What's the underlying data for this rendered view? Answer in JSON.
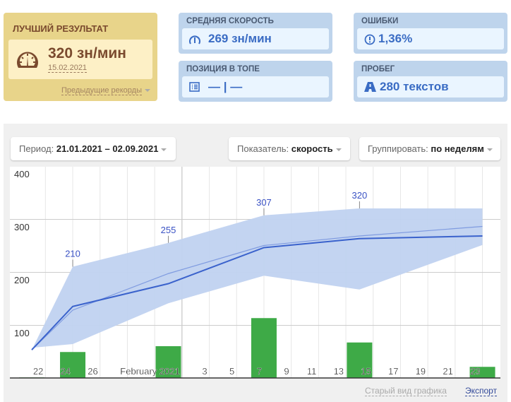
{
  "best": {
    "title": "ЛУЧШИЙ РЕЗУЛЬТАТ",
    "value": "320 зн/мин",
    "date": "15.02.2021",
    "prev_label": "Предыдущие рекорды",
    "icon": "speedometer-icon"
  },
  "avg_speed": {
    "title": "СРЕДНЯЯ СКОРОСТЬ",
    "value": "269 зн/мин",
    "icon": "speedometer-icon"
  },
  "errors": {
    "title": "ОШИБКИ",
    "value": "1,36%",
    "icon": "exclamation-circle-icon"
  },
  "position": {
    "title": "ПОЗИЦИЯ В ТОПЕ",
    "value": "— | —",
    "icon": "list-icon"
  },
  "mileage": {
    "title": "ПРОБЕГ",
    "value": "280 текстов",
    "icon": "road-icon"
  },
  "controls": {
    "period_label": "Период:",
    "period_value": "21.01.2021 – 02.09.2021",
    "metric_label": "Показатель:",
    "metric_value": "скорость",
    "group_label": "Группировать:",
    "group_value": "по неделям"
  },
  "footer": {
    "old_view": "Старый вид графика",
    "export": "Экспорт"
  },
  "colors": {
    "band": "#c0d2f0",
    "mean": "#3a62cc",
    "trend": "#7f9be0",
    "bars": "#3eaa47"
  },
  "chart_data": {
    "type": "line",
    "title": "",
    "xlabel": "",
    "ylabel": "",
    "ylim": [
      0,
      400
    ],
    "y_ticks": [
      "100",
      "200",
      "300",
      "400"
    ],
    "x_ticks": [
      {
        "label": "22",
        "day": 1
      },
      {
        "label": "24",
        "day": 3
      },
      {
        "label": "26",
        "day": 5
      },
      {
        "label": "February 2021",
        "day": 11
      },
      {
        "label": "3",
        "day": 13
      },
      {
        "label": "5",
        "day": 15
      },
      {
        "label": "7",
        "day": 17
      },
      {
        "label": "9",
        "day": 19
      },
      {
        "label": "11",
        "day": 21
      },
      {
        "label": "13",
        "day": 23
      },
      {
        "label": "15",
        "day": 25
      },
      {
        "label": "17",
        "day": 27
      },
      {
        "label": "19",
        "day": 29
      },
      {
        "label": "21",
        "day": 31
      },
      {
        "label": "23",
        "day": 33
      }
    ],
    "x_days_from_2021_01_21": [
      0,
      3,
      10,
      17,
      24,
      33
    ],
    "series": [
      {
        "name": "max",
        "values": [
          53,
          210,
          255,
          307,
          320,
          320
        ]
      },
      {
        "name": "min",
        "values": [
          57,
          64,
          141,
          193,
          167,
          251
        ]
      },
      {
        "name": "average",
        "values": [
          53,
          135,
          178,
          246,
          263,
          268
        ]
      },
      {
        "name": "trend",
        "values": [
          53,
          128,
          197,
          250,
          268,
          286
        ]
      },
      {
        "name": "texts",
        "type": "bar",
        "values": [
          1,
          49,
          60,
          113,
          67,
          21
        ]
      }
    ],
    "peak_labels": [
      {
        "index": 1,
        "text": "210"
      },
      {
        "index": 2,
        "text": "255"
      },
      {
        "index": 3,
        "text": "307"
      },
      {
        "index": 4,
        "text": "320"
      }
    ]
  }
}
